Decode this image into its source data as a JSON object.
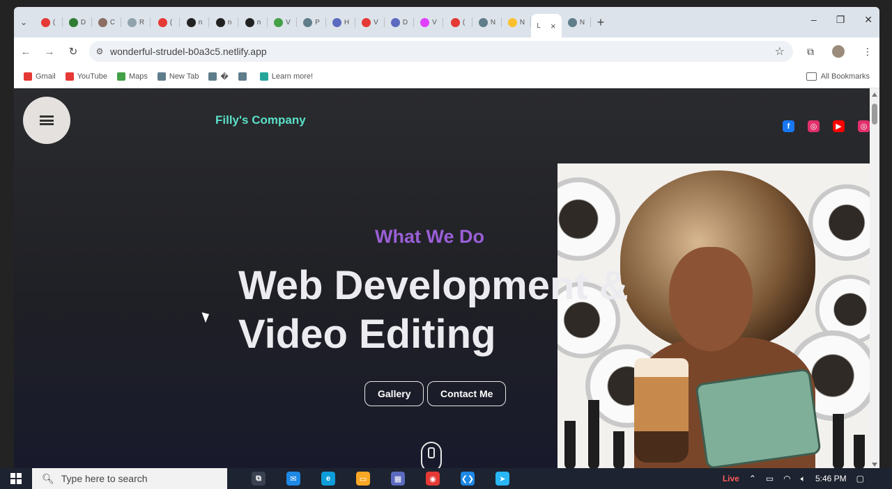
{
  "browser": {
    "tabs": [
      {
        "label": "(",
        "color": "#e53935"
      },
      {
        "label": "D",
        "color": "#2e7d32"
      },
      {
        "label": "C",
        "color": "#8d6e63"
      },
      {
        "label": "R",
        "color": "#90a4ae"
      },
      {
        "label": "(",
        "color": "#e53935"
      },
      {
        "label": "n",
        "color": "#222222"
      },
      {
        "label": "n",
        "color": "#222222"
      },
      {
        "label": "n",
        "color": "#222222"
      },
      {
        "label": "V",
        "color": "#43a047"
      },
      {
        "label": "P",
        "color": "#607d8b"
      },
      {
        "label": "H",
        "color": "#5c6bc0"
      },
      {
        "label": "V",
        "color": "#e53935"
      },
      {
        "label": "D",
        "color": "#5c6bc0"
      },
      {
        "label": "V",
        "color": "#e040fb"
      },
      {
        "label": "(",
        "color": "#e53935"
      },
      {
        "label": "N",
        "color": "#607d8b"
      },
      {
        "label": "N",
        "color": "#fbc02d"
      }
    ],
    "active_tab": {
      "label": "L",
      "close": "×"
    },
    "extra_tab": {
      "label": "N",
      "color": "#607d8b"
    },
    "new_tab": "+",
    "url": "wonderful-strudel-b0a3c5.netlify.app",
    "bookmarks": [
      {
        "label": "Gmail",
        "color": "#e53935"
      },
      {
        "label": "YouTube",
        "color": "#e53935"
      },
      {
        "label": "Maps",
        "color": "#43a047"
      },
      {
        "label": "New Tab",
        "color": "#607d8b"
      },
      {
        "label": "�",
        "color": "#607d8b"
      },
      {
        "label": "",
        "color": "#607d8b"
      },
      {
        "label": "Learn more!",
        "color": "#26a69a"
      }
    ],
    "all_bookmarks": "All Bookmarks"
  },
  "site": {
    "brand": "Filly's Company",
    "socials": [
      {
        "name": "facebook",
        "color": "#1877f2",
        "glyph": "f"
      },
      {
        "name": "instagram",
        "color": "#e1306c",
        "glyph": "◎"
      },
      {
        "name": "youtube",
        "color": "#ff0000",
        "glyph": "▶"
      },
      {
        "name": "instagram",
        "color": "#e1306c",
        "glyph": "◎"
      }
    ],
    "eyebrow": "What We Do",
    "headline_line1": "Web Development &",
    "headline_line2": "Video Editing",
    "buttons": {
      "gallery": "Gallery",
      "contact": "Contact Me"
    }
  },
  "taskbar": {
    "search_placeholder": "Type here to search",
    "apps": [
      {
        "name": "task-view",
        "color": "#3a4150",
        "glyph": "⧉"
      },
      {
        "name": "mail",
        "color": "#1e88e5",
        "glyph": "✉"
      },
      {
        "name": "edge",
        "color": "#0d9dda",
        "glyph": "e"
      },
      {
        "name": "file-explorer",
        "color": "#f9a825",
        "glyph": "▭"
      },
      {
        "name": "store",
        "color": "#5c6bc0",
        "glyph": "▦"
      },
      {
        "name": "chrome",
        "color": "#e53935",
        "glyph": "◉"
      },
      {
        "name": "vscode",
        "color": "#1e88e5",
        "glyph": "❮❯"
      },
      {
        "name": "telegram",
        "color": "#29b6f6",
        "glyph": "➤"
      }
    ],
    "live": "Live",
    "time": "5:46 PM"
  },
  "colors": {
    "brand": "#5be0c8",
    "eyebrow": "#9a5fd6",
    "headline": "#ecebf0"
  }
}
